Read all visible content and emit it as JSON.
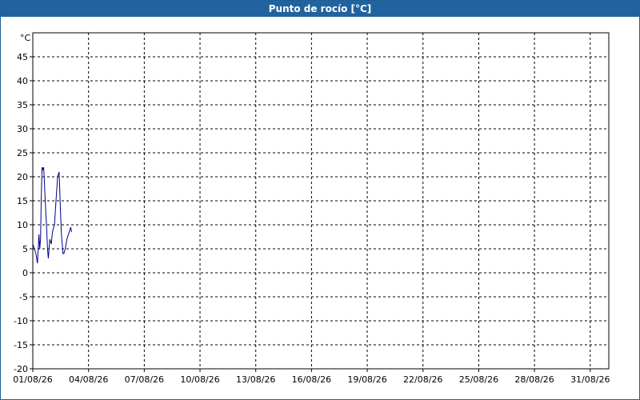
{
  "window": {
    "title": "Punto de rocío [°C]"
  },
  "chart_data": {
    "type": "line",
    "title": "Punto de rocío [°C]",
    "ylabel": "°C",
    "xlabel": "",
    "ylim": [
      -20,
      50
    ],
    "xlim": [
      "01/08/26",
      "01/09/26"
    ],
    "grid": true,
    "yticks": [
      -20,
      -15,
      -10,
      -5,
      0,
      5,
      10,
      15,
      20,
      25,
      30,
      35,
      40,
      45
    ],
    "xticks": [
      "01/08/26",
      "04/08/26",
      "07/08/26",
      "10/08/26",
      "13/08/26",
      "16/08/26",
      "19/08/26",
      "22/08/26",
      "25/08/26",
      "28/08/26",
      "31/08/26"
    ],
    "series": [
      {
        "color": "#00008b",
        "x": [
          "01/08/26 00:00",
          "01/08/26 02:00",
          "01/08/26 04:00",
          "01/08/26 06:00",
          "01/08/26 07:00",
          "01/08/26 08:00",
          "01/08/26 09:00",
          "01/08/26 10:00",
          "01/08/26 11:00",
          "01/08/26 12:00",
          "01/08/26 13:00",
          "01/08/26 14:00",
          "01/08/26 15:00",
          "01/08/26 16:00",
          "01/08/26 17:00",
          "01/08/26 18:00",
          "01/08/26 19:00",
          "01/08/26 20:00",
          "01/08/26 22:00",
          "02/08/26 00:00",
          "02/08/26 01:00",
          "02/08/26 02:00",
          "02/08/26 04:00",
          "02/08/26 06:00",
          "02/08/26 08:00",
          "02/08/26 10:00",
          "02/08/26 12:00",
          "02/08/26 13:00",
          "02/08/26 14:00",
          "02/08/26 15:00",
          "02/08/26 16:00",
          "02/08/26 17:00",
          "02/08/26 18:00",
          "02/08/26 20:00",
          "02/08/26 22:00",
          "03/08/26 00:00",
          "03/08/26 01:00",
          "03/08/26 02:00"
        ],
        "y": [
          6,
          5,
          4,
          2,
          5,
          8,
          5,
          7,
          16,
          22,
          21.5,
          22,
          19,
          15,
          12,
          9,
          5,
          3,
          7,
          6,
          8,
          9,
          10,
          15,
          20,
          21,
          12,
          8,
          6,
          4,
          4,
          4.5,
          5,
          7,
          8,
          9,
          9.5,
          8.5
        ]
      }
    ]
  }
}
